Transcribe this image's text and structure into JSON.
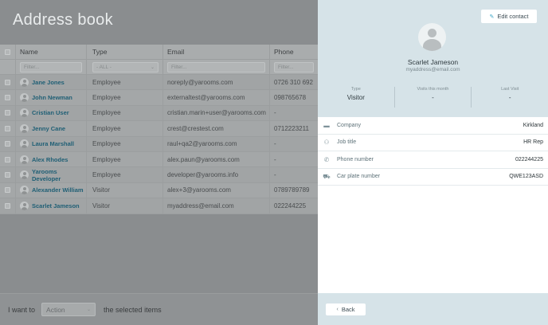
{
  "page": {
    "title": "Address book"
  },
  "table": {
    "headers": [
      "Name",
      "Type",
      "Email",
      "Phone"
    ],
    "filters": {
      "name_placeholder": "Filter...",
      "type_value": "- ALL -",
      "email_placeholder": "Filter...",
      "phone_placeholder": "Filter..."
    },
    "rows": [
      {
        "name": "Jane Jones",
        "type": "Employee",
        "email": "noreply@yarooms.com",
        "phone": "0726 310 692"
      },
      {
        "name": "John Newman",
        "type": "Employee",
        "email": "externaltest@yarooms.com",
        "phone": "098765678"
      },
      {
        "name": "Cristian User",
        "type": "Employee",
        "email": "cristian.marin+user@yarooms.com",
        "phone": "-"
      },
      {
        "name": "Jenny Cane",
        "type": "Employee",
        "email": "crest@crestest.com",
        "phone": "0712223211"
      },
      {
        "name": "Laura Marshall",
        "type": "Employee",
        "email": "raul+qa2@yarooms.com",
        "phone": "-"
      },
      {
        "name": "Alex Rhodes",
        "type": "Employee",
        "email": "alex.paun@yarooms.com",
        "phone": "-"
      },
      {
        "name": "Yarooms Developer",
        "type": "Employee",
        "email": "developer@yarooms.info",
        "phone": "-"
      },
      {
        "name": "Alexander William",
        "type": "Visitor",
        "email": "alex+3@yarooms.com",
        "phone": "0789789789"
      },
      {
        "name": "Scarlet Jameson",
        "type": "Visitor",
        "email": "myaddress@email.com",
        "phone": "022244225"
      }
    ]
  },
  "bulk": {
    "prefix": "I want to",
    "action_value": "Action",
    "suffix": "the selected items"
  },
  "detail": {
    "edit_label": "Edit contact",
    "name": "Scarlet Jameson",
    "email": "myaddress@email.com",
    "stats": [
      {
        "label": "Type",
        "value": "Visitor"
      },
      {
        "label": "Visits this month",
        "value": "-"
      },
      {
        "label": "Last Visit",
        "value": "-"
      }
    ],
    "fields": [
      {
        "icon": "briefcase-icon",
        "label": "Company",
        "value": "Kirkland"
      },
      {
        "icon": "people-icon",
        "label": "Job title",
        "value": "HR Rep"
      },
      {
        "icon": "phone-icon",
        "label": "Phone number",
        "value": "022244225"
      },
      {
        "icon": "car-icon",
        "label": "Car plate number",
        "value": "QWE123ASD"
      }
    ],
    "back_label": "Back"
  }
}
